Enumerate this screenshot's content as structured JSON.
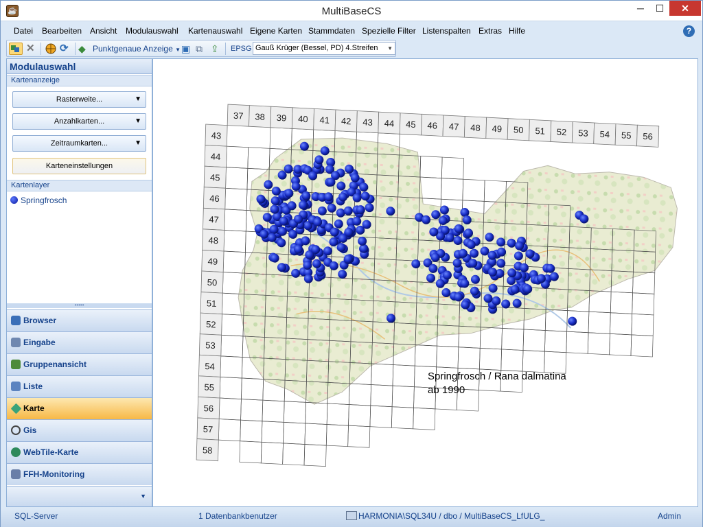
{
  "window": {
    "title": "MultiBaseCS",
    "minimize": "─",
    "maximize": "☐",
    "close": "✕"
  },
  "menu": [
    "Datei",
    "Bearbeiten",
    "Ansicht",
    "Modulauswahl",
    "Kartenauswahl",
    "Eigene Karten",
    "Stammdaten",
    "Spezielle Filter",
    "Listenspalten",
    "Extras",
    "Hilfe"
  ],
  "toolbar": {
    "display_mode": "Punktgenaue Anzeige",
    "epsg_label": "EPSG",
    "epsg_value": "Gauß Krüger (Bessel, PD) 4.Streifen"
  },
  "left_panel": {
    "title": "Modulauswahl",
    "group_kartenanzeige": "Kartenanzeige",
    "rasterweite": "Rasterweite...",
    "anzahlkarten": "Anzahlkarten...",
    "zeitraumkarten": "Zeitraumkarten...",
    "karteneinstellungen": "Karteneinstellungen",
    "group_kartenlayer": "Kartenlayer",
    "layer": "Springfrosch",
    "splitter": "•••••"
  },
  "nav": [
    {
      "label": "Browser",
      "icon": "browser-icon",
      "color": "#3a6fb8"
    },
    {
      "label": "Eingabe",
      "icon": "input-icon",
      "color": "#6f88b0"
    },
    {
      "label": "Gruppenansicht",
      "icon": "group-view-icon",
      "color": "#4d8a3a"
    },
    {
      "label": "Liste",
      "icon": "list-icon",
      "color": "#5b83c0"
    },
    {
      "label": "Karte",
      "icon": "map-gem-icon",
      "color": "#3aa37a"
    },
    {
      "label": "Gis",
      "icon": "globe-icon",
      "color": "#444444"
    },
    {
      "label": "WebTile-Karte",
      "icon": "webtile-icon",
      "color": "#2f8a5b"
    },
    {
      "label": "FFH-Monitoring",
      "icon": "monitoring-icon",
      "color": "#6a7fa8"
    }
  ],
  "map": {
    "col_labels": [
      "37",
      "38",
      "39",
      "40",
      "41",
      "42",
      "43",
      "44",
      "45",
      "46",
      "47",
      "48",
      "49",
      "50",
      "51",
      "52",
      "53",
      "54",
      "55",
      "56"
    ],
    "row_labels": [
      "43",
      "44",
      "45",
      "46",
      "47",
      "48",
      "49",
      "50",
      "51",
      "52",
      "53",
      "54",
      "55",
      "56",
      "57",
      "58"
    ],
    "caption_line1": "Springfrosch / Rana dalmatina",
    "caption_line2": "ab 1990",
    "dot_color": "#1a2fc8"
  },
  "status": {
    "server": "SQL-Server",
    "users": "1 Datenbankbenutzer",
    "connection": "HARMONIA\\SQL34U / dbo / MultiBaseCS_LfULG_",
    "user": "Admin"
  }
}
